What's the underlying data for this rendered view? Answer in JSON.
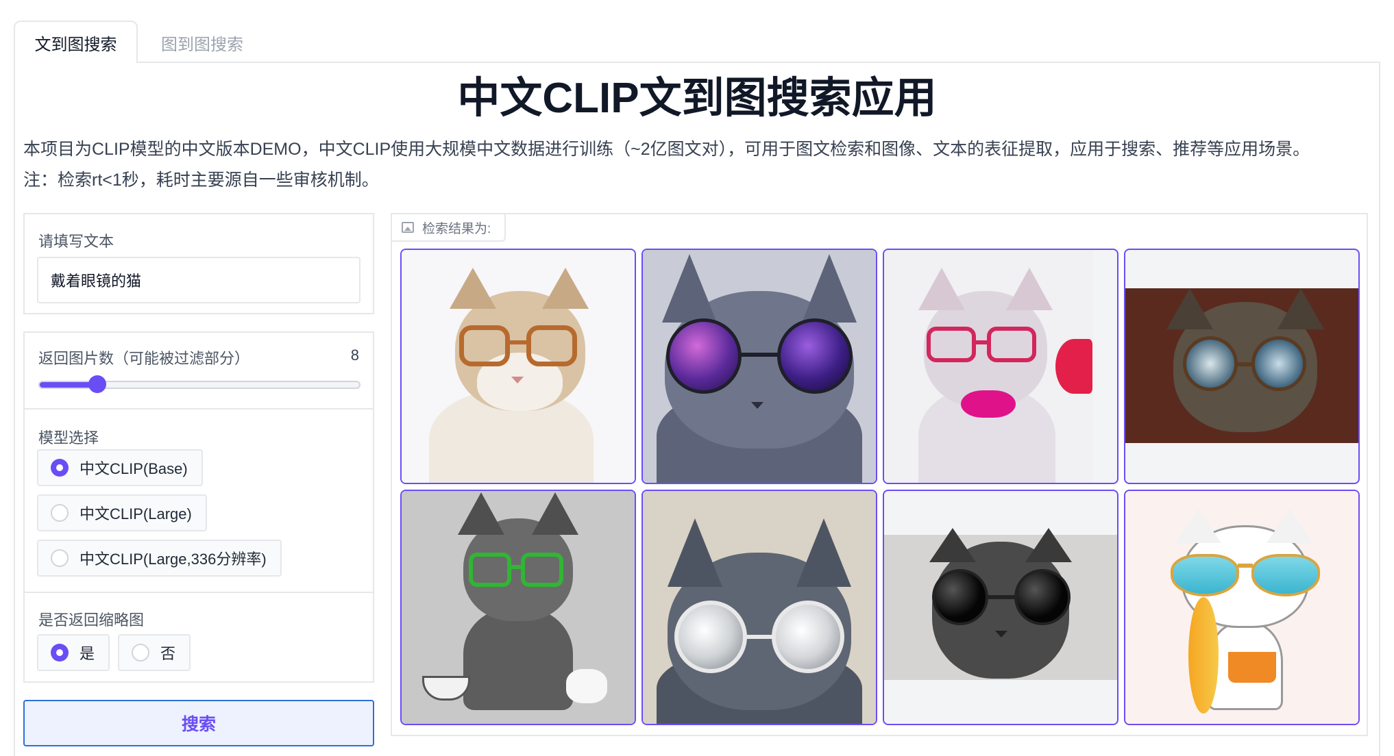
{
  "tabs": [
    {
      "label": "文到图搜索",
      "active": true
    },
    {
      "label": "图到图搜索",
      "active": false
    }
  ],
  "title": "中文CLIP文到图搜索应用",
  "description": [
    "本项目为CLIP模型的中文版本DEMO，中文CLIP使用大规模中文数据进行训练（~2亿图文对），可用于图文检索和图像、文本的表征提取，应用于搜索、推荐等应用场景。",
    "注：检索rt<1秒，耗时主要源自一些审核机制。"
  ],
  "text_input": {
    "label": "请填写文本",
    "value": "戴着眼镜的猫"
  },
  "count_slider": {
    "label": "返回图片数（可能被过滤部分）",
    "value": "8",
    "fill_fraction": 0.18
  },
  "model_select": {
    "label": "模型选择",
    "options": [
      "中文CLIP(Base)",
      "中文CLIP(Large)",
      "中文CLIP(Large,336分辨率)"
    ],
    "selected": "中文CLIP(Base)"
  },
  "thumbnail_toggle": {
    "label": "是否返回缩略图",
    "options": [
      "是",
      "否"
    ],
    "selected": "是"
  },
  "search_button": {
    "label": "搜索"
  },
  "results": {
    "label": "检索结果为:",
    "accent": "#6b4df5",
    "images": [
      {
        "name": "cat-orange-glasses",
        "bg": "#f7f6f9"
      },
      {
        "name": "cat-purple-galaxy-glasses",
        "bg": "#6b7389"
      },
      {
        "name": "cat-pink-bowtie-glasses",
        "bg": "#f1f1f3"
      },
      {
        "name": "cat-reflective-glasses",
        "bg": "#5a2a1e"
      },
      {
        "name": "cat-green-glasses-sketch",
        "bg": "#c8c8c8"
      },
      {
        "name": "cat-mirror-goggles",
        "bg": "#d9d2c6"
      },
      {
        "name": "cat-black-round-glasses",
        "bg": "#d6d4d2"
      },
      {
        "name": "cat-cartoon-sunglasses-surfboard",
        "bg": "#fbf1ef"
      }
    ]
  }
}
